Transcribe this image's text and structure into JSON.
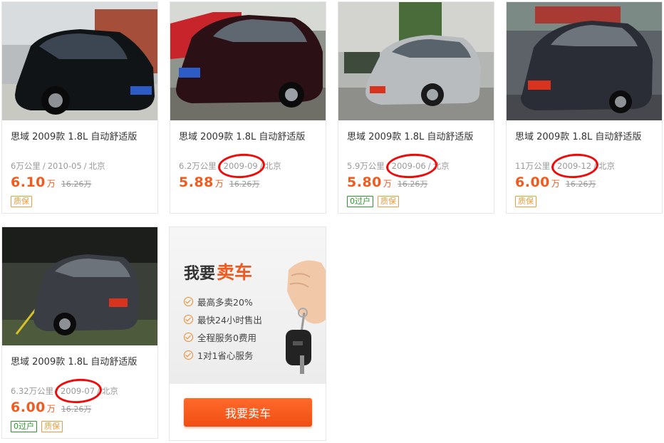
{
  "listings": [
    {
      "title": "思域 2009款 1.8L 自动舒适版",
      "mileage": "6万公里",
      "date": "2010-05",
      "city": "北京",
      "price": "6.10",
      "unit": "万",
      "original": "16.26万",
      "tags": [
        "质保"
      ],
      "circled": false,
      "photo": "black-sedan-parking-lot"
    },
    {
      "title": "思域 2009款 1.8L 自动舒适版",
      "mileage": "6.2万公里",
      "date": "2009-09",
      "city": "北京",
      "price": "5.88",
      "unit": "万",
      "original": "16.26万",
      "tags": [],
      "circled": true,
      "photo": "dark-red-sedan-street"
    },
    {
      "title": "思域 2009款 1.8L 自动舒适版",
      "mileage": "5.9万公里",
      "date": "2009-06",
      "city": "北京",
      "price": "5.80",
      "unit": "万",
      "original": "16.26万",
      "tags": [
        "0过户",
        "质保"
      ],
      "circled": true,
      "photo": "silver-sedan-courtyard"
    },
    {
      "title": "思域 2009款 1.8L 自动舒适版",
      "mileage": "11万公里",
      "date": "2009-12",
      "city": "北京",
      "price": "6.00",
      "unit": "万",
      "original": "16.26万",
      "tags": [
        "质保"
      ],
      "circled": true,
      "photo": "dark-grey-sedan-street"
    },
    {
      "title": "思域 2009款 1.8L 自动舒适版",
      "mileage": "6.32万公里",
      "date": "2009-07",
      "city": "北京",
      "price": "6.00",
      "unit": "万",
      "original": "16.26万",
      "tags": [
        "0过户",
        "质保"
      ],
      "circled": true,
      "photo": "grey-sedan-underground-garage"
    }
  ],
  "meta_separator": "/",
  "promo": {
    "heading_prefix": "我要",
    "heading_accent": "卖车",
    "benefits": [
      "最高多卖20%",
      "最快24小时售出",
      "全程服务0费用",
      "1对1省心服务"
    ],
    "button_label": "我要卖车",
    "image": "hand-holding-car-key"
  },
  "colors": {
    "price": "#f25b1f",
    "annotation_circle": "#f10a0a",
    "tag_transfer": "#2a9a2a",
    "tag_warranty": "#f39a3b",
    "button": "#f04e13"
  }
}
